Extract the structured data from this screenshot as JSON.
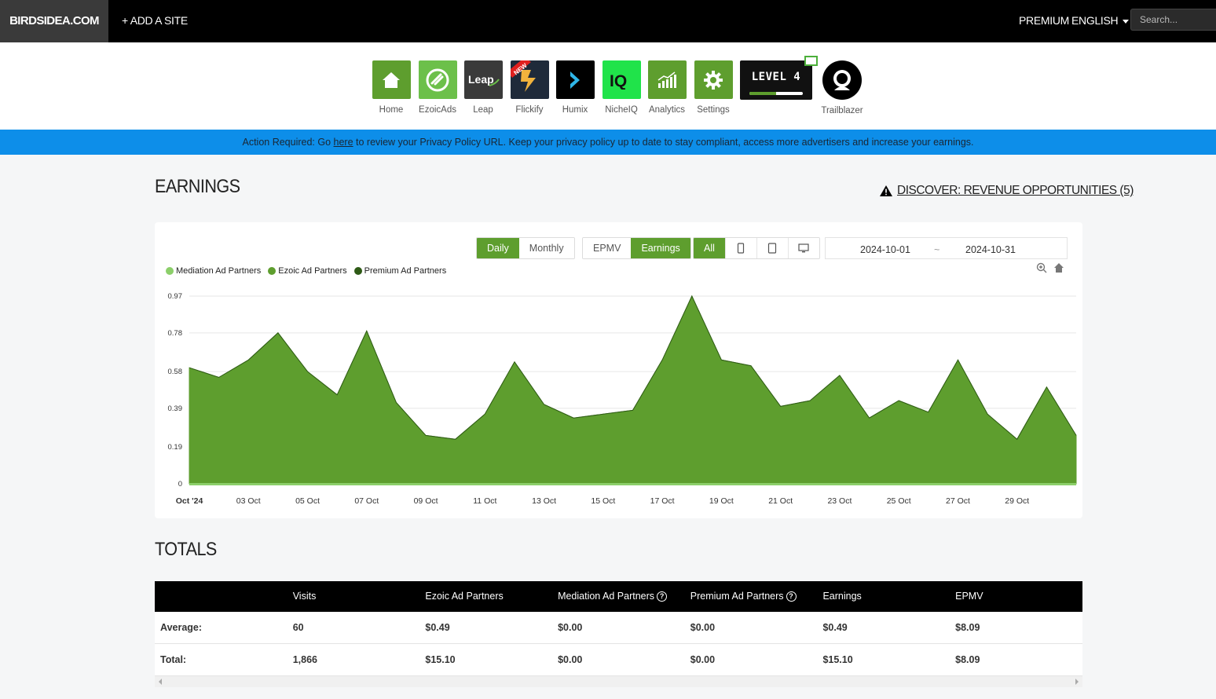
{
  "topbar": {
    "brand": "BIRDSIDEA.COM",
    "add_site": "+ ADD A SITE",
    "premium": "PREMIUM",
    "language": "ENGLISH",
    "search_placeholder": "Search..."
  },
  "apps": [
    {
      "label": "Home",
      "icon": "house-icon",
      "color": "#5e9e2e"
    },
    {
      "label": "EzoicAds",
      "icon": "ezoicads-icon",
      "color": "#6cc04a"
    },
    {
      "label": "Leap",
      "icon": "leap-icon",
      "color": "#3a3a3a"
    },
    {
      "label": "Flickify",
      "icon": "flickify-icon",
      "color": "#1f2a3a",
      "badge": "NEW"
    },
    {
      "label": "Humix",
      "icon": "humix-icon",
      "color": "#000000"
    },
    {
      "label": "NicheIQ",
      "icon": "nicheiq-icon",
      "color": "#20e34a"
    },
    {
      "label": "Analytics",
      "icon": "analytics-icon",
      "color": "#5e9e2e"
    },
    {
      "label": "Settings",
      "icon": "gear-icon",
      "color": "#5e9e2e"
    }
  ],
  "level": {
    "label": "LEVEL 4",
    "progress": 0.5
  },
  "trailblazer": {
    "label": "Trailblazer",
    "icon": "astronaut-icon"
  },
  "banner": {
    "prefix": "Action Required: Go ",
    "link": "here",
    "suffix": " to review your Privacy Policy URL. Keep your privacy policy up to date to stay compliant, access more advertisers and increase your earnings."
  },
  "earnings": {
    "title": "EARNINGS",
    "discover": "DISCOVER: REVENUE OPPORTUNITIES (5)",
    "period_buttons": [
      "Daily",
      "Monthly"
    ],
    "period_active": "Daily",
    "metric_buttons": [
      "EPMV",
      "Earnings"
    ],
    "metric_active": "Earnings",
    "device_all": "All",
    "date_from": "2024-10-01",
    "date_sep": "~",
    "date_to": "2024-10-31"
  },
  "chart_data": {
    "type": "area",
    "series": [
      {
        "name": "Mediation Ad Partners",
        "color": "#8ccf6a",
        "values": [
          0,
          0,
          0,
          0,
          0,
          0,
          0,
          0,
          0,
          0,
          0,
          0,
          0,
          0,
          0,
          0,
          0,
          0,
          0,
          0,
          0,
          0,
          0,
          0,
          0,
          0,
          0,
          0,
          0,
          0,
          0
        ]
      },
      {
        "name": "Ezoic Ad Partners",
        "color": "#5e9e2e",
        "values": [
          0.6,
          0.55,
          0.64,
          0.78,
          0.58,
          0.46,
          0.79,
          0.42,
          0.25,
          0.23,
          0.36,
          0.63,
          0.41,
          0.34,
          0.36,
          0.38,
          0.64,
          0.97,
          0.64,
          0.61,
          0.4,
          0.43,
          0.56,
          0.34,
          0.43,
          0.37,
          0.64,
          0.36,
          0.23,
          0.5,
          0.25
        ]
      },
      {
        "name": "Premium Ad Partners",
        "color": "#2e5a16",
        "values": [
          0,
          0,
          0,
          0,
          0,
          0,
          0,
          0,
          0,
          0,
          0,
          0,
          0,
          0,
          0,
          0,
          0,
          0,
          0,
          0,
          0,
          0,
          0,
          0,
          0,
          0,
          0,
          0,
          0,
          0,
          0
        ]
      }
    ],
    "x_labels": [
      "Oct '24",
      "03 Oct",
      "05 Oct",
      "07 Oct",
      "09 Oct",
      "11 Oct",
      "13 Oct",
      "15 Oct",
      "17 Oct",
      "19 Oct",
      "21 Oct",
      "23 Oct",
      "25 Oct",
      "27 Oct",
      "29 Oct"
    ],
    "y_ticks": [
      "0",
      "0.19",
      "0.39",
      "0.58",
      "0.78",
      "0.97"
    ],
    "ylim": [
      0,
      0.97
    ],
    "grid": true,
    "legend_position": "top-left"
  },
  "totals": {
    "title": "TOTALS",
    "headers": [
      "",
      "Visits",
      "Ezoic Ad Partners",
      "Mediation Ad Partners",
      "Premium Ad Partners",
      "Earnings",
      "EPMV"
    ],
    "rows": [
      [
        "Average:",
        "60",
        "$0.49",
        "$0.00",
        "$0.00",
        "$0.49",
        "$8.09"
      ],
      [
        "Total:",
        "1,866",
        "$15.10",
        "$0.00",
        "$0.00",
        "$15.10",
        "$8.09"
      ]
    ]
  }
}
